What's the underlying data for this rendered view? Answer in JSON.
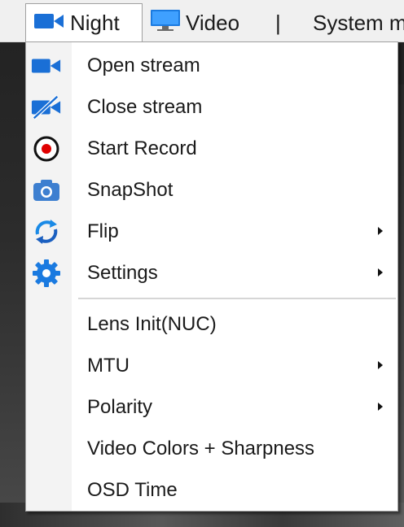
{
  "menubar": {
    "items": [
      {
        "label": "Night",
        "icon": "camera-icon"
      },
      {
        "label": "Video",
        "icon": "monitor-icon"
      },
      {
        "label": "|"
      },
      {
        "label": "System m"
      }
    ]
  },
  "menu": {
    "items": [
      {
        "label": "Open stream",
        "icon": "camera-icon"
      },
      {
        "label": "Close stream",
        "icon": "camera-off-icon"
      },
      {
        "label": "Start Record",
        "icon": "record-icon"
      },
      {
        "label": "SnapShot",
        "icon": "snapshot-camera-icon"
      },
      {
        "label": "Flip",
        "icon": "flip-arrows-icon",
        "submenu": true
      },
      {
        "label": "Settings",
        "icon": "gear-icon",
        "submenu": true
      },
      {
        "label": "Lens Init(NUC)"
      },
      {
        "label": "MTU",
        "submenu": true
      },
      {
        "label": "Polarity",
        "submenu": true
      },
      {
        "label": "Video Colors + Sharpness"
      },
      {
        "label": "OSD Time"
      }
    ]
  },
  "colors": {
    "accent": "#1a6fd6",
    "record_red": "#e00000"
  }
}
